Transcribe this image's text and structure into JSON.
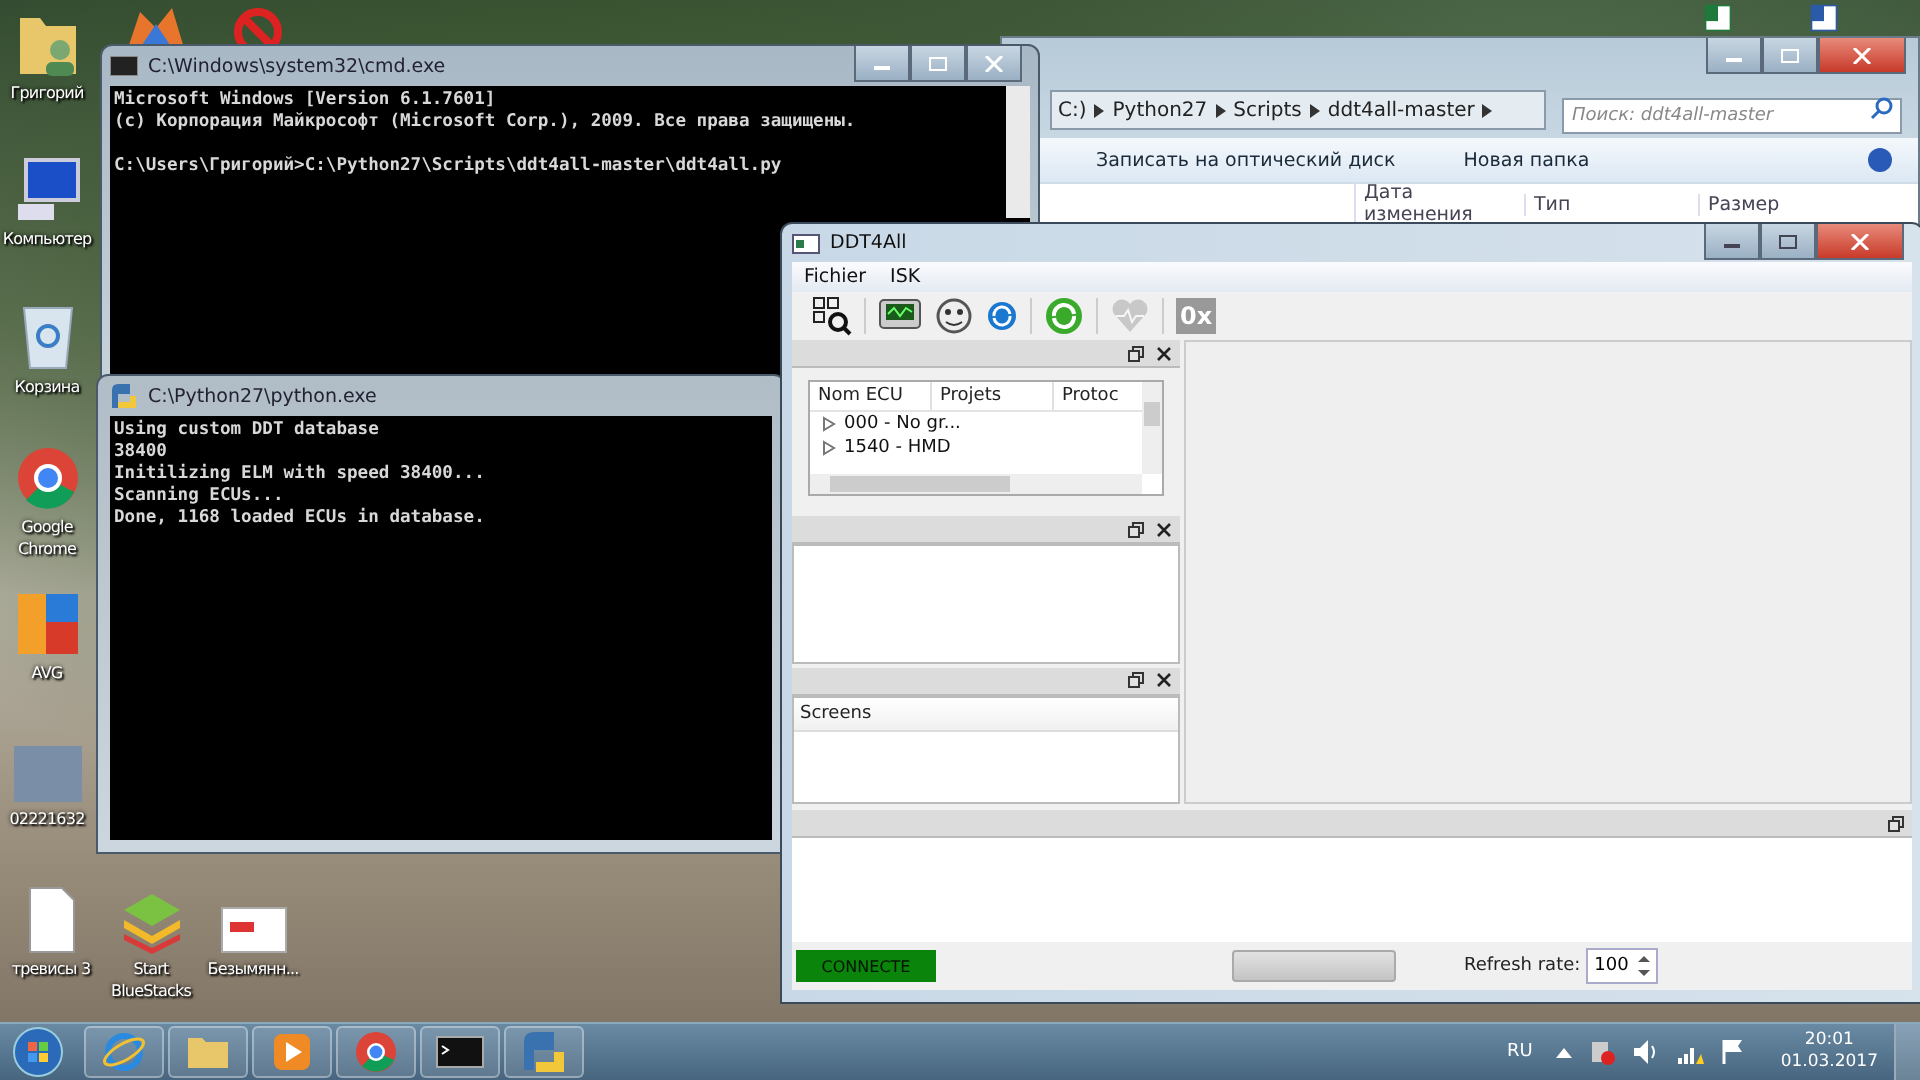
{
  "desktop": {
    "icons": [
      {
        "label": "Григорий",
        "kind": "userfolder"
      },
      {
        "label": "Компьютер",
        "kind": "computer"
      },
      {
        "label": "Корзина",
        "kind": "trash"
      },
      {
        "label": "Google Chrome",
        "kind": "chrome"
      },
      {
        "label": "AVG",
        "kind": "avg"
      },
      {
        "label": "02221632",
        "kind": "photo"
      },
      {
        "label": "тревисы 3",
        "kind": "document"
      },
      {
        "label": "Start BlueStacks",
        "kind": "bluestacks"
      },
      {
        "label": "Безымянн...",
        "kind": "image"
      }
    ]
  },
  "explorer_window": {
    "breadcrumb": [
      "C:)",
      "Python27",
      "Scripts",
      "ddt4all-master"
    ],
    "search": {
      "placeholder": "Поиск: ddt4all-master"
    },
    "toolbar": [
      "Записать на оптический диск",
      "Новая папка"
    ],
    "columns": [
      "Дата изменения",
      "Тип",
      "Размер"
    ]
  },
  "cmd_window": {
    "title": "C:\\Windows\\system32\\cmd.exe",
    "lines": [
      "Microsoft Windows [Version 6.1.7601]",
      "(c) Корпорация Майкрософт (Microsoft Corp.), 2009. Все права защищены."
    ],
    "prompt": "C:\\Users\\Григорий>C:\\Python27\\Scripts\\ddt4all-master\\ddt4all.py"
  },
  "python_window": {
    "title": "C:\\Python27\\python.exe",
    "lines": [
      "Using custom DDT database",
      "38400",
      "Initilizing ELM with speed 38400...",
      "Scanning ECUs...",
      "Done, 1168 loaded ECUs in database."
    ]
  },
  "ddt_window": {
    "title": "DDT4All",
    "menu": [
      "Fichier",
      "ISK"
    ],
    "toolbar": [
      {
        "kind": "scan",
        "disabled": false
      },
      {
        "kind": "monitor",
        "disabled": false
      },
      {
        "kind": "dial",
        "disabled": false
      },
      {
        "kind": "refresh",
        "disabled": false
      },
      {
        "kind": "sync",
        "disabled": false
      },
      {
        "kind": "heart",
        "disabled": true
      },
      {
        "kind": "hex",
        "label": "0x",
        "disabled": true
      }
    ],
    "ecu_panel": {
      "columns": [
        "Nom ECU",
        "Projets",
        "Protoc"
      ],
      "rows": [
        {
          "label": "000 - No gr...",
          "expanded": false
        },
        {
          "label": "1540 - HMD",
          "expanded": false
        }
      ]
    },
    "screens_panel": {
      "header": "Screens"
    },
    "status": {
      "connection": "CONNECTE",
      "connected": true,
      "progress": {
        "level": 0
      },
      "refresh_label": "Refresh rate:",
      "refresh_value": "100"
    }
  },
  "taskbar": {
    "apps": [
      {
        "kind": "ie"
      },
      {
        "kind": "explorer"
      },
      {
        "kind": "media"
      },
      {
        "kind": "chrome"
      },
      {
        "kind": "cmd"
      },
      {
        "kind": "python"
      }
    ],
    "language": "RU",
    "time": "20:01",
    "date": "01.03.2017"
  }
}
